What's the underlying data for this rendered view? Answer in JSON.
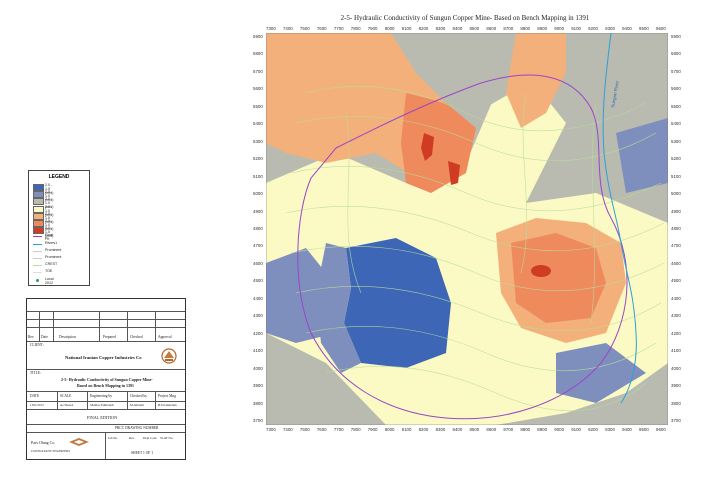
{
  "map": {
    "title": "2-5- Hydraulic Conductivity of Sungun Copper Mine- Based on Bench Mapping in 1391",
    "x_ticks": [
      "7300",
      "7400",
      "7500",
      "7600",
      "7700",
      "7800",
      "7900",
      "8000",
      "8100",
      "8200",
      "8300",
      "8400",
      "8500",
      "8600",
      "8700",
      "8800",
      "8900",
      "9000",
      "9100",
      "9200",
      "9300",
      "9400",
      "9500",
      "9600"
    ],
    "y_ticks": [
      "5900",
      "5800",
      "5700",
      "5600",
      "5500",
      "5400",
      "5300",
      "5200",
      "5100",
      "5000",
      "4900",
      "4800",
      "4700",
      "4600",
      "4500",
      "4400",
      "4300",
      "4200",
      "4100",
      "4000",
      "3900",
      "3800",
      "3700"
    ],
    "river_label": "Sungun River",
    "colors": {
      "k1": "#3d67b6",
      "k2": "#7f8fbd",
      "k3": "#b9bab0",
      "k4": "#fbfac4",
      "k5": "#f4b07a",
      "k6": "#ef8a5d",
      "k7": "#cf3b23",
      "final_pit": "#9a45c9",
      "river": "#2d9fd8",
      "contour": "#b7dd9a"
    }
  },
  "legend": {
    "title": "LEGEND",
    "items": [
      {
        "label": "2.0 - 1.5 (m/d)",
        "kind": "box",
        "color": "#3d67b6"
      },
      {
        "label": "2.5 - 1.0 (m/d)",
        "kind": "box",
        "color": "#7f8fbd"
      },
      {
        "label": "2.0 - 1.0 (m/d)",
        "kind": "box",
        "color": "#b9bab0"
      },
      {
        "label": "2.5 - 1.0 (m/d)",
        "kind": "box",
        "color": "#fbfac4"
      },
      {
        "label": "2.5 - 1.5 (m/d)",
        "kind": "box",
        "color": "#f4b07a"
      },
      {
        "label": "2.5 - 1.0 (m/d)",
        "kind": "box",
        "color": "#ef8a5d"
      },
      {
        "label": "3.0 - 1.5 (m/d)",
        "kind": "box",
        "color": "#cf3b23"
      },
      {
        "label": "Final Pit",
        "kind": "line",
        "color": "#9a45c9"
      },
      {
        "label": "Rivers1",
        "kind": "line",
        "color": "#2d9fd8"
      },
      {
        "label": "Prominent",
        "kind": "line",
        "color": "#cccccc"
      },
      {
        "label": "Prominent",
        "kind": "line",
        "color": "#cccccc"
      },
      {
        "label": "CREST",
        "kind": "line",
        "color": "#b7dd9a"
      },
      {
        "label": "TOE",
        "kind": "line",
        "color": "#dddddd"
      },
      {
        "label": "Local 2012",
        "kind": "dot",
        "color": "#2a9d55"
      }
    ]
  },
  "title_block": {
    "rev_headers": [
      "Rev",
      "Date",
      "Description",
      "Prepared",
      "Checked",
      "Approval"
    ],
    "client_label": "CLIENT:",
    "client_name": "National Iranian Copper Industries Co",
    "title_label": "TITLE:",
    "title_line1": "2-5- Hydraulic Conductivity of Sungun Copper Mine-",
    "title_line2": "Based on Bench Mapping in 1391",
    "info_headers": [
      "DATE",
      "SCALE",
      "Engineering by",
      "Checked by",
      "Project Mng"
    ],
    "info_values": [
      "1391/2013",
      "As Shown",
      "Shamsa Fakhraieh",
      "M.Jahromi",
      "B.Tavakkolian"
    ],
    "edition": "FINAL EDITION",
    "company": "Pars Olang Co.",
    "company_sub": "CONSULTANT ENGINEERS",
    "drawing_header": "PRCC DRAWING NUMBER",
    "drawing_cols": [
      "Job No.",
      "Rev.",
      "Dept Code",
      "SCAT No."
    ],
    "sheet": "SHEET 1 OF 1"
  }
}
